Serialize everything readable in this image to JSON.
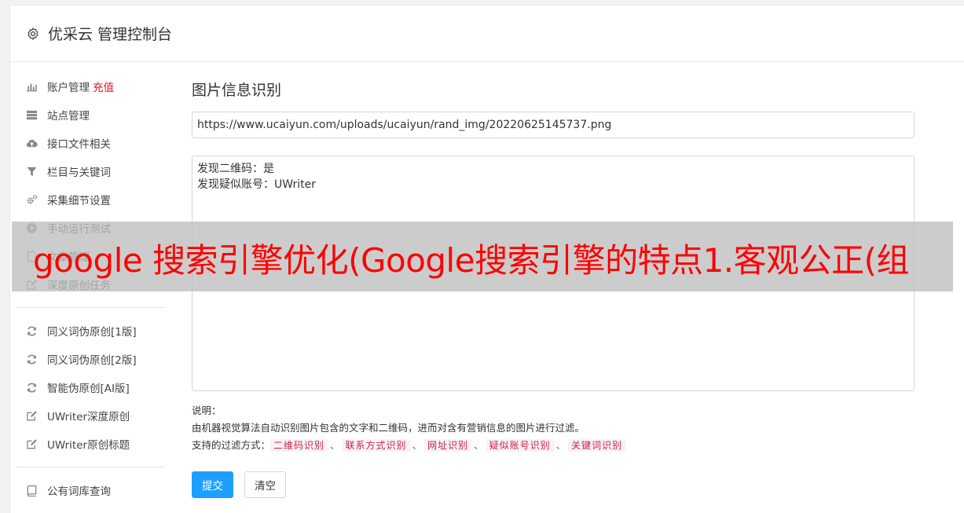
{
  "header": {
    "title": "优采云 管理控制台"
  },
  "sidebar": {
    "group1": [
      {
        "label": "账户管理",
        "extra": "充值",
        "icon": "bar-chart-icon"
      },
      {
        "label": "站点管理",
        "icon": "server-icon"
      },
      {
        "label": "接口文件相关",
        "icon": "cloud-upload-icon"
      },
      {
        "label": "栏目与关键词",
        "icon": "filter-icon"
      },
      {
        "label": "采集细节设置",
        "icon": "gears-icon"
      },
      {
        "label": "手动运行测试",
        "icon": "play-circle-icon"
      },
      {
        "label": "文章管理",
        "icon": "file-icon"
      },
      {
        "label": "深度原创任务",
        "icon": "edit-icon"
      }
    ],
    "group2": [
      {
        "label": "同义词伪原创[1版]",
        "icon": "refresh-icon"
      },
      {
        "label": "同义词伪原创[2版]",
        "icon": "refresh-icon"
      },
      {
        "label": "智能伪原创[AI版]",
        "icon": "refresh-icon"
      },
      {
        "label": "UWriter深度原创",
        "icon": "edit-icon"
      },
      {
        "label": "UWriter原创标题",
        "icon": "edit-icon"
      }
    ],
    "group3": [
      {
        "label": "公有词库查询",
        "icon": "book-icon"
      }
    ]
  },
  "main": {
    "title": "图片信息识别",
    "url_value": "https://www.ucaiyun.com/uploads/ucaiyun/rand_img/20220625145737.png",
    "result_lines": [
      "发现二维码：是",
      "发现疑似账号：UWriter"
    ],
    "notes_label": "说明：",
    "notes_desc": "由机器视觉算法自动识别图片包含的文字和二维码，进而对含有营销信息的图片进行过滤。",
    "filter_label": "支持的过滤方式：",
    "filters": [
      "二维码识别",
      "联系方式识别",
      "网址识别",
      "疑似账号识别",
      "关键词识别"
    ],
    "submit_label": "提交",
    "clear_label": "清空"
  },
  "overlay": {
    "text": "google 搜索引擎优化(Google搜索引擎的特点1.客观公正(组"
  },
  "colors": {
    "accent": "#1e9fff",
    "highlight": "#e0161a",
    "overlay_text": "#ff0000",
    "tag": "#c7254e"
  }
}
